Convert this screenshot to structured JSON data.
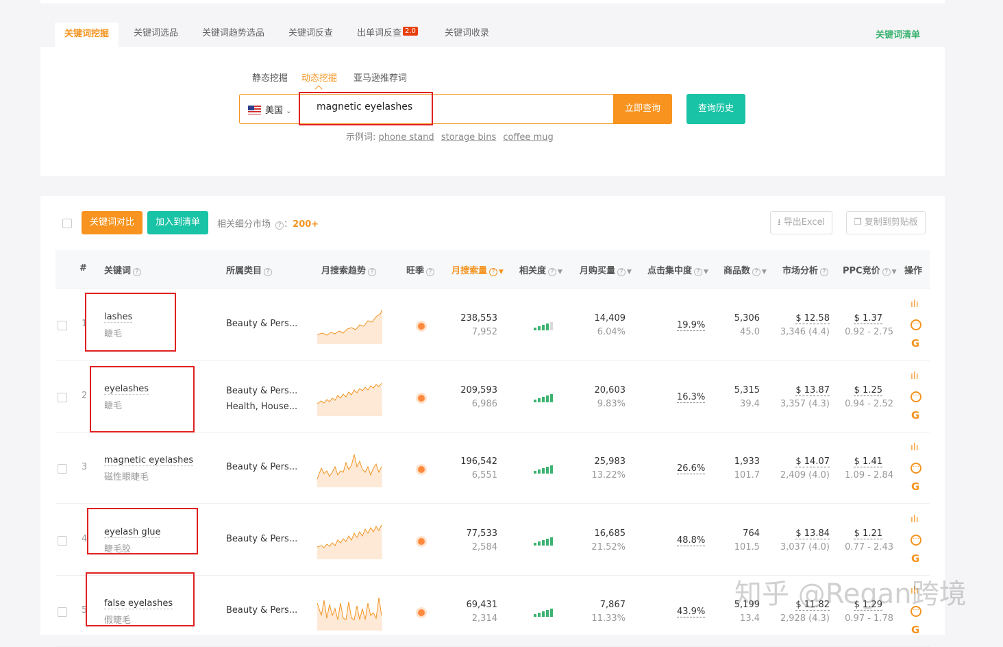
{
  "tabs": [
    {
      "label": "关键词挖掘",
      "active": true
    },
    {
      "label": "关键词选品"
    },
    {
      "label": "关键词趋势选品"
    },
    {
      "label": "关键词反查"
    },
    {
      "label": "出单词反查",
      "badge": "2.0"
    },
    {
      "label": "关键词收录"
    }
  ],
  "keyword_list_link": "关键词清单",
  "subtabs": [
    {
      "label": "静态挖掘"
    },
    {
      "label": "动态挖掘",
      "active": true
    },
    {
      "label": "亚马逊推荐词"
    }
  ],
  "search": {
    "country": "美国",
    "value": "magnetic eyelashes",
    "query_button": "立即查询",
    "history_button": "查询历史",
    "examples_label": "示例词:",
    "examples": [
      "phone stand",
      "storage bins",
      "coffee mug"
    ]
  },
  "toolbar": {
    "compare_button": "关键词对比",
    "add_list_button": "加入到清单",
    "market_label": "相关细分市场",
    "market_sep": "：",
    "market_count": "200+",
    "export_button": "导出Excel",
    "copy_button": "复制到剪贴板"
  },
  "columns": [
    "#",
    "关键词",
    "所属类目",
    "月搜索趋势",
    "旺季",
    "月搜索量",
    "相关度",
    "月购买量",
    "点击集中度",
    "商品数",
    "市场分析",
    "PPC竞价",
    "操作"
  ],
  "rows": [
    {
      "index": "1",
      "keyword": "lashes",
      "keyword_cn": "睫毛",
      "categories": [
        "Beauty & Pers..."
      ],
      "search_volume": "238,553",
      "search_volume_sub": "7,952",
      "relevance": 4,
      "purchases": "14,409",
      "purchase_rate": "6.04%",
      "click_concentration": "19.9%",
      "products": "5,306",
      "products_sub": "45.0",
      "market_price": "$ 12.58",
      "market_sub": "3,346 (4.4)",
      "ppc": "$ 1.37",
      "ppc_range": "0.92 - 2.75"
    },
    {
      "index": "2",
      "keyword": "eyelashes",
      "keyword_cn": "睫毛",
      "categories": [
        "Beauty & Pers...",
        "Health, House..."
      ],
      "search_volume": "209,593",
      "search_volume_sub": "6,986",
      "relevance": 5,
      "purchases": "20,603",
      "purchase_rate": "9.83%",
      "click_concentration": "16.3%",
      "products": "5,315",
      "products_sub": "39.4",
      "market_price": "$ 13.87",
      "market_sub": "3,357 (4.3)",
      "ppc": "$ 1.25",
      "ppc_range": "0.94 - 2.52"
    },
    {
      "index": "3",
      "keyword": "magnetic eyelashes",
      "keyword_cn": "磁性眼睫毛",
      "categories": [
        "Beauty & Pers..."
      ],
      "search_volume": "196,542",
      "search_volume_sub": "6,551",
      "relevance": 5,
      "purchases": "25,983",
      "purchase_rate": "13.22%",
      "click_concentration": "26.6%",
      "products": "1,933",
      "products_sub": "101.7",
      "market_price": "$ 14.07",
      "market_sub": "2,409 (4.0)",
      "ppc": "$ 1.41",
      "ppc_range": "1.09 - 2.84"
    },
    {
      "index": "4",
      "keyword": "eyelash glue",
      "keyword_cn": "睫毛胶",
      "categories": [
        "Beauty & Pers..."
      ],
      "search_volume": "77,533",
      "search_volume_sub": "2,584",
      "relevance": 5,
      "purchases": "16,685",
      "purchase_rate": "21.52%",
      "click_concentration": "48.8%",
      "products": "764",
      "products_sub": "101.5",
      "market_price": "$ 13.84",
      "market_sub": "3,037 (4.0)",
      "ppc": "$ 1.21",
      "ppc_range": "0.77 - 2.43"
    },
    {
      "index": "5",
      "keyword": "false eyelashes",
      "keyword_cn": "假睫毛",
      "categories": [
        "Beauty & Pers..."
      ],
      "search_volume": "69,431",
      "search_volume_sub": "2,314",
      "relevance": 5,
      "purchases": "7,867",
      "purchase_rate": "11.33%",
      "click_concentration": "43.9%",
      "products": "5,199",
      "products_sub": "13.4",
      "market_price": "$ 11.82",
      "market_sub": "2,928 (4.3)",
      "ppc": "$ 1.29",
      "ppc_range": "0.97 - 1.78"
    }
  ],
  "icons": {
    "ops": [
      "bar-chart-icon",
      "more-icon",
      "google-icon"
    ],
    "peak_season": "orange-dot-icon",
    "relevance": "signal-bars-icon"
  },
  "colors": {
    "accent": "#f39420",
    "teal": "#19c3a6",
    "green": "#3cb371",
    "highlight_box": "#e02020"
  },
  "watermark": "知乎 @Regan跨境"
}
